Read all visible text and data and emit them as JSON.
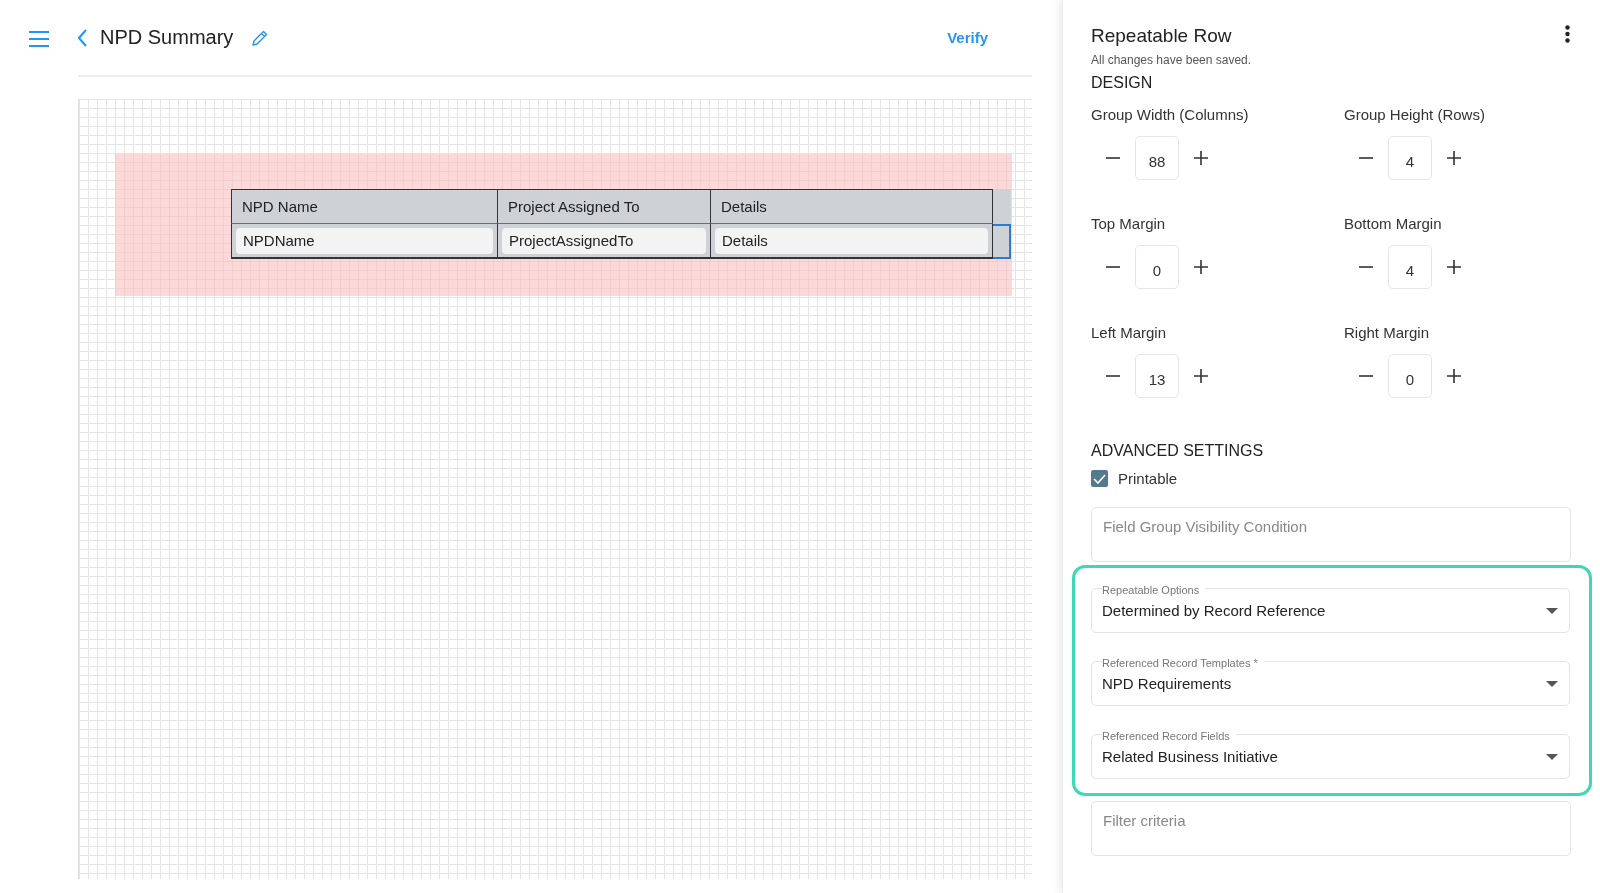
{
  "header": {
    "title": "NPD Summary",
    "verify_button": "Verify"
  },
  "canvas": {
    "table": {
      "columns": [
        "NPD Name",
        "Project Assigned To",
        "Details"
      ],
      "row": [
        "NPDName",
        "ProjectAssignedTo",
        "Details"
      ]
    }
  },
  "panel": {
    "title": "Repeatable Row",
    "save_status": "All changes have been saved.",
    "design_heading": "DESIGN",
    "steppers": [
      {
        "label": "Group Width (Columns)",
        "value": "88"
      },
      {
        "label": "Group Height (Rows)",
        "value": "4"
      },
      {
        "label": "Top Margin",
        "value": "0"
      },
      {
        "label": "Bottom Margin",
        "value": "4"
      },
      {
        "label": "Left Margin",
        "value": "13"
      },
      {
        "label": "Right Margin",
        "value": "0"
      }
    ],
    "advanced_heading": "ADVANCED SETTINGS",
    "printable": {
      "label": "Printable",
      "checked": true
    },
    "visibility_field": {
      "placeholder": "Field Group Visibility Condition"
    },
    "highlighted_selects": [
      {
        "label": "Repeatable Options",
        "value": "Determined by Record Reference"
      },
      {
        "label": "Referenced Record Templates *",
        "value": "NPD Requirements"
      },
      {
        "label": "Referenced Record Fields",
        "value": "Related Business Initiative"
      }
    ],
    "filter_field": {
      "placeholder": "Filter criteria"
    }
  }
}
